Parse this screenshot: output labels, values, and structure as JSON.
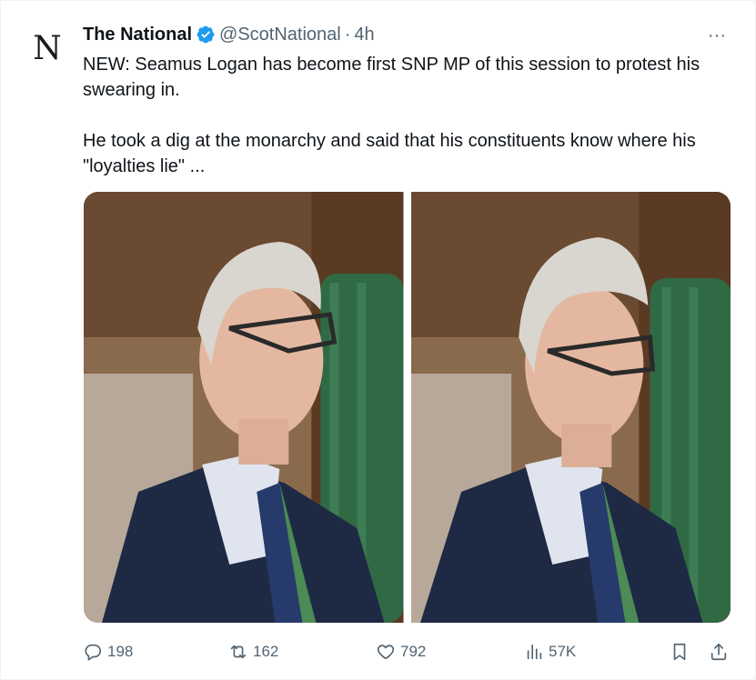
{
  "tweet": {
    "avatar_letter": "N",
    "author_name": "The National",
    "handle": "@ScotNational",
    "separator": "·",
    "time": "4h",
    "more_label": "···",
    "text_p1": "NEW: Seamus Logan has become first SNP MP of this session to protest his swearing in.",
    "text_p2": "He took a dig at the monarchy and said that his constituents know where his \"loyalties lie\" ...",
    "verified_color": "#1d9bf0"
  },
  "media": {
    "images": [
      {
        "icon": "photo-left"
      },
      {
        "icon": "photo-right"
      }
    ]
  },
  "actions": {
    "replies": "198",
    "retweets": "162",
    "likes": "792",
    "views": "57K"
  }
}
